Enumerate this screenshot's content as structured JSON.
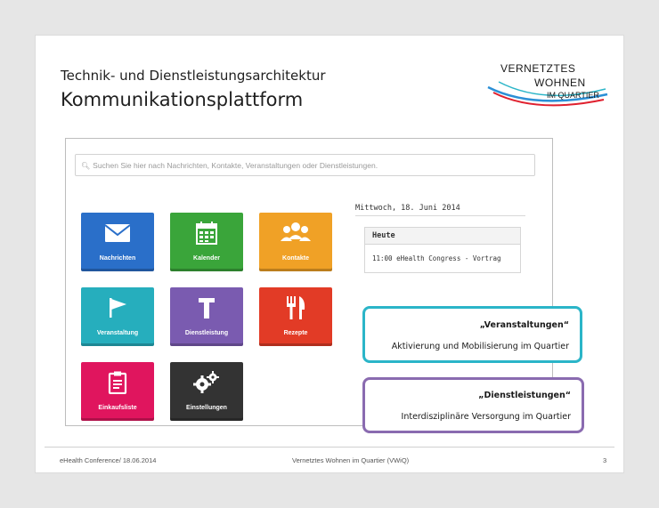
{
  "slide": {
    "title_line1": "Technik- und Dienstleistungsarchitektur",
    "title_line2": "Kommunikationsplattform",
    "logo": {
      "line1": "VERNETZTES",
      "line2": "WOHNEN",
      "line3": "IM QUARTIER"
    }
  },
  "app": {
    "search_placeholder": "Suchen Sie hier nach Nachrichten, Kontakte, Veranstaltungen oder Dienstleistungen.",
    "tiles": [
      {
        "label": "Nachrichten",
        "icon": "envelope-icon",
        "color": "#2a6fc9"
      },
      {
        "label": "Kalender",
        "icon": "calendar-icon",
        "color": "#3aa53a"
      },
      {
        "label": "Kontakte",
        "icon": "contacts-icon",
        "color": "#f0a126"
      },
      {
        "label": "Veranstaltung",
        "icon": "flag-icon",
        "color": "#26aebd"
      },
      {
        "label": "Dienstleistung",
        "icon": "hammer-icon",
        "color": "#7a5bb0"
      },
      {
        "label": "Rezepte",
        "icon": "fork-knife-icon",
        "color": "#e23b26"
      },
      {
        "label": "Einkaufsliste",
        "icon": "clipboard-icon",
        "color": "#e0155e"
      },
      {
        "label": "Einstellungen",
        "icon": "gears-icon",
        "color": "#333333"
      }
    ],
    "date": "Mittwoch, 18. Juni 2014",
    "today_header": "Heute",
    "event": "11:00  eHealth Congress - Vortrag"
  },
  "callouts": [
    {
      "title": "„Veranstaltungen“",
      "text": "Aktivierung und Mobilisierung im Quartier",
      "color": "#2bb5c8"
    },
    {
      "title": "„Dienstleistungen“",
      "text": "Interdisziplinäre Versorgung im Quartier",
      "color": "#8a6bb0"
    }
  ],
  "footer": {
    "left": "eHealth Conference/ 18.06.2014",
    "center": "Vernetztes Wohnen im Quartier (VWiQ)",
    "page": "3"
  }
}
